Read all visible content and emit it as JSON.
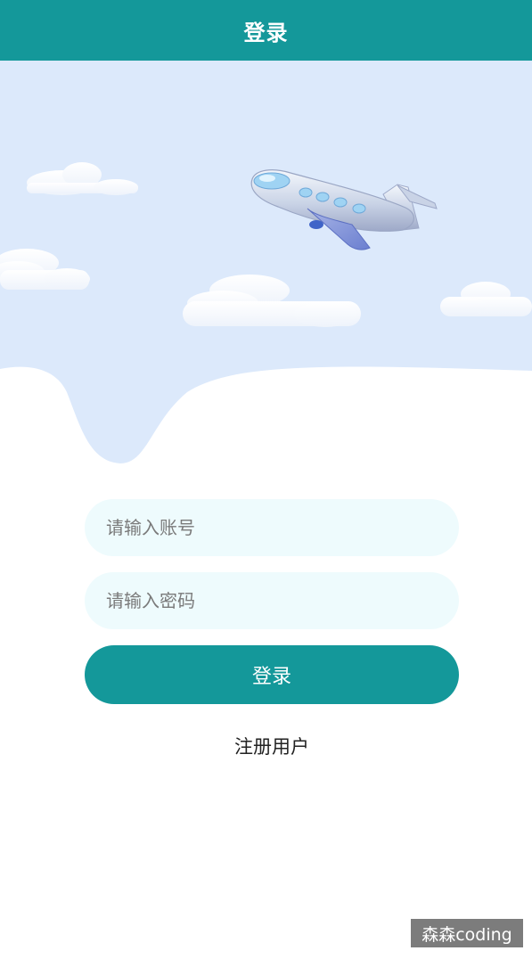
{
  "header": {
    "title": "登录"
  },
  "form": {
    "account_placeholder": "请输入账号",
    "password_placeholder": "请输入密码",
    "login_label": "登录",
    "register_label": "注册用户"
  },
  "watermark": {
    "text": "森森coding"
  },
  "colors": {
    "primary": "#14989a",
    "sky": "#dce9fb",
    "field_bg": "#eefbfd"
  }
}
